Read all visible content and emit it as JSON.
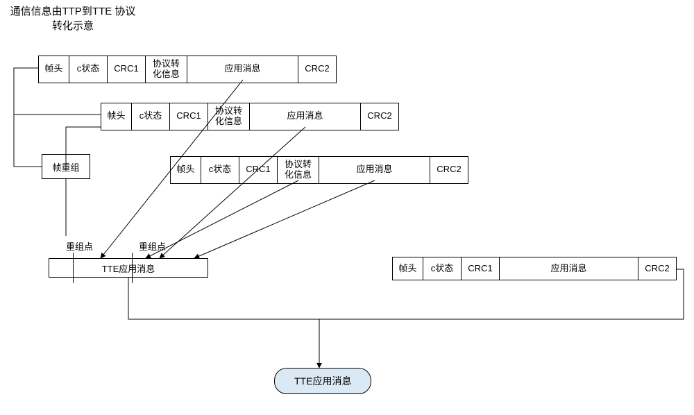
{
  "title": "通信信息由TTP到TTE\n协议转化示意",
  "frame_cells": [
    "帧头",
    "c状态",
    "CRC1",
    "协议转\n化信息",
    "应用消息",
    "CRC2"
  ],
  "frame4_cells": [
    "帧头",
    "c状态",
    "CRC1",
    "应用消息",
    "CRC2"
  ],
  "reassemble_box": "帧重组",
  "reassembly_point": "重组点",
  "tte_app_msg_box": "TTE应用消息",
  "terminal": "TTE应用消息"
}
